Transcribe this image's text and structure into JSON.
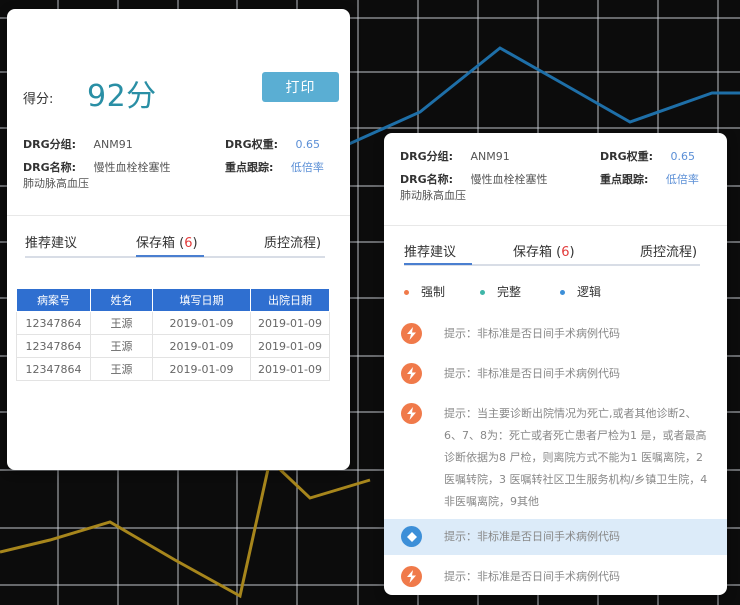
{
  "left_card": {
    "score_label": "得分:",
    "score_value": "92分",
    "print_label": "打印",
    "drg_group_label": "DRG分组:",
    "drg_group_value": "ANM91",
    "drg_weight_label": "DRG权重:",
    "drg_weight_value": "0.65",
    "drg_name_label": "DRG名称:",
    "drg_name_value": "慢性血栓栓塞性",
    "drg_name_cont": "肺动脉高血压",
    "focus_label": "重点跟踪:",
    "focus_value": "低倍率",
    "tabs": {
      "recommend": "推荐建议",
      "box": "保存箱",
      "box_count": "6",
      "qc": "质控流程)"
    },
    "table": {
      "headers": [
        "病案号",
        "姓名",
        "填写日期",
        "出院日期"
      ],
      "rows": [
        [
          "12347864",
          "王源",
          "2019-01-09",
          "2019-01-09"
        ],
        [
          "12347864",
          "王源",
          "2019-01-09",
          "2019-01-09"
        ],
        [
          "12347864",
          "王源",
          "2019-01-09",
          "2019-01-09"
        ]
      ]
    }
  },
  "right_card": {
    "drg_group_label": "DRG分组:",
    "drg_group_value": "ANM91",
    "drg_weight_label": "DRG权重:",
    "drg_weight_value": "0.65",
    "drg_name_label": "DRG名称:",
    "drg_name_value": "慢性血栓栓塞性",
    "drg_name_cont": "肺动脉高血压",
    "focus_label": "重点跟踪:",
    "focus_value": "低倍率",
    "tabs": {
      "recommend": "推荐建议",
      "box": "保存箱",
      "box_count": "6",
      "qc": "质控流程)"
    },
    "legend": [
      {
        "label": "强制",
        "color": "#f07a4a"
      },
      {
        "label": "完整",
        "color": "#3fb6a8"
      },
      {
        "label": "逻辑",
        "color": "#3d8fd8"
      }
    ],
    "hints": [
      {
        "text": "提示：非标准是否日间手术病例代码",
        "icon": "lightning-icon"
      },
      {
        "text": "提示：非标准是否日间手术病例代码",
        "icon": "lightning-icon"
      },
      {
        "text": "提示：当主要诊断出院情况为死亡,或者其他诊断2、6、7、8为：死亡或者死亡患者尸检为1 是，或者最高诊断依据为8 尸检，则离院方式不能为1 医嘱离院，2 医嘱转院，3 医嘱转社区卫生服务机构/乡镇卫生院，4 非医嘱离院，9其他",
        "icon": "lightning-icon"
      },
      {
        "text": "提示：非标准是否日间手术病例代码",
        "icon": "diamond-icon"
      },
      {
        "text": "提示：非标准是否日间手术病例代码",
        "icon": "lightning-icon"
      }
    ]
  },
  "colors": {
    "accent_teal": "#2a8fa5",
    "print_button": "#5aaed3",
    "table_header": "#2f6fd0",
    "link_blue": "#5b8fd6",
    "count_red": "#e23b3b",
    "background_line_blue": "#1e6fa8",
    "background_line_gold": "#a7861c"
  }
}
